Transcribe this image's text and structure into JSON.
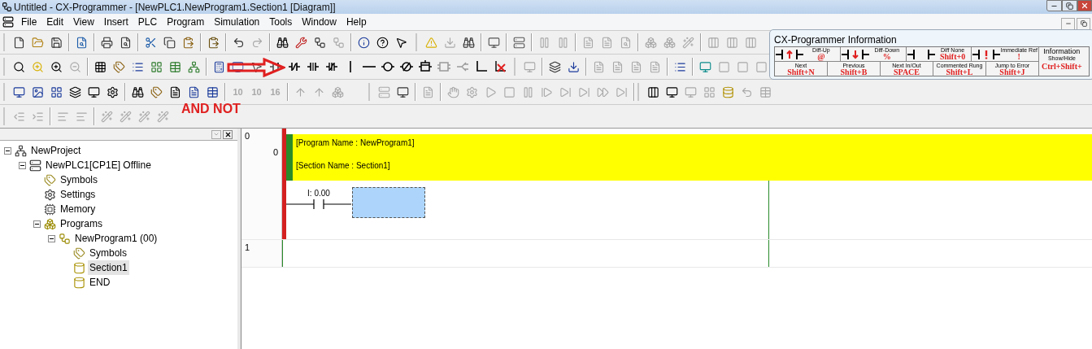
{
  "window": {
    "title": "Untitled - CX-Programmer - [NewPLC1.NewProgram1.Section1 [Diagram]]"
  },
  "menu": [
    "File",
    "Edit",
    "View",
    "Insert",
    "PLC",
    "Program",
    "Simulation",
    "Tools",
    "Window",
    "Help"
  ],
  "toolbar": {
    "number_buttons": [
      {
        "label": "10",
        "disabled": true
      },
      {
        "label": "10",
        "disabled": true
      },
      {
        "label": "16",
        "disabled": true
      }
    ]
  },
  "annotation": {
    "text": "AND NOT"
  },
  "project_tree": {
    "items": [
      {
        "label": "NewProject",
        "kind": "project",
        "expanded": true,
        "selected": false,
        "children": [
          {
            "label": "NewPLC1[CP1E] Offline",
            "kind": "plc",
            "expanded": true,
            "selected": false,
            "children": [
              {
                "label": "Symbols",
                "kind": "symbols",
                "selected": false
              },
              {
                "label": "Settings",
                "kind": "settings",
                "selected": false
              },
              {
                "label": "Memory",
                "kind": "memory",
                "selected": false
              },
              {
                "label": "Programs",
                "kind": "programs",
                "expanded": true,
                "selected": false,
                "children": [
                  {
                    "label": "NewProgram1 (00)",
                    "kind": "program",
                    "expanded": true,
                    "selected": false,
                    "children": [
                      {
                        "label": "Symbols",
                        "kind": "symbols",
                        "selected": false
                      },
                      {
                        "label": "Section1",
                        "kind": "section",
                        "selected": true
                      },
                      {
                        "label": "END",
                        "kind": "section",
                        "selected": false
                      }
                    ]
                  }
                ]
              }
            ]
          }
        ]
      }
    ]
  },
  "diagram": {
    "rungs": [
      {
        "number": "0",
        "step": "0",
        "error": true,
        "comments": [
          "[Program Name : NewProgram1]",
          "[Section Name : Section1]"
        ],
        "contact": {
          "address": "I: 0.00"
        },
        "cursor": true
      },
      {
        "number": "1",
        "error": false
      }
    ]
  },
  "info_panel": {
    "title": "CX-Programmer Information",
    "top_cells": [
      {
        "kind": "up",
        "label": "Diff-Up",
        "key": "@"
      },
      {
        "kind": "down",
        "label": "Diff-Down",
        "key": "%"
      },
      {
        "kind": "none",
        "label": "Diff None",
        "key": "Shift+0"
      },
      {
        "kind": "immediate",
        "label": "Immediate Ref",
        "key": "!"
      }
    ],
    "bottom_cells": [
      {
        "label": "Next",
        "key": "Shift+N"
      },
      {
        "label": "Previous",
        "key": "Shift+B"
      },
      {
        "label": "Next In/Out",
        "key": "SPACE"
      }
    ],
    "right_cells": [
      {
        "label": "Commented Rung",
        "key": "Shift+L"
      },
      {
        "label": "Jump to Error",
        "key": "Shift+J"
      }
    ],
    "side_cell": {
      "label": "Information",
      "sublabel": "Show/Hide",
      "key": "Ctrl+Shift+"
    }
  }
}
